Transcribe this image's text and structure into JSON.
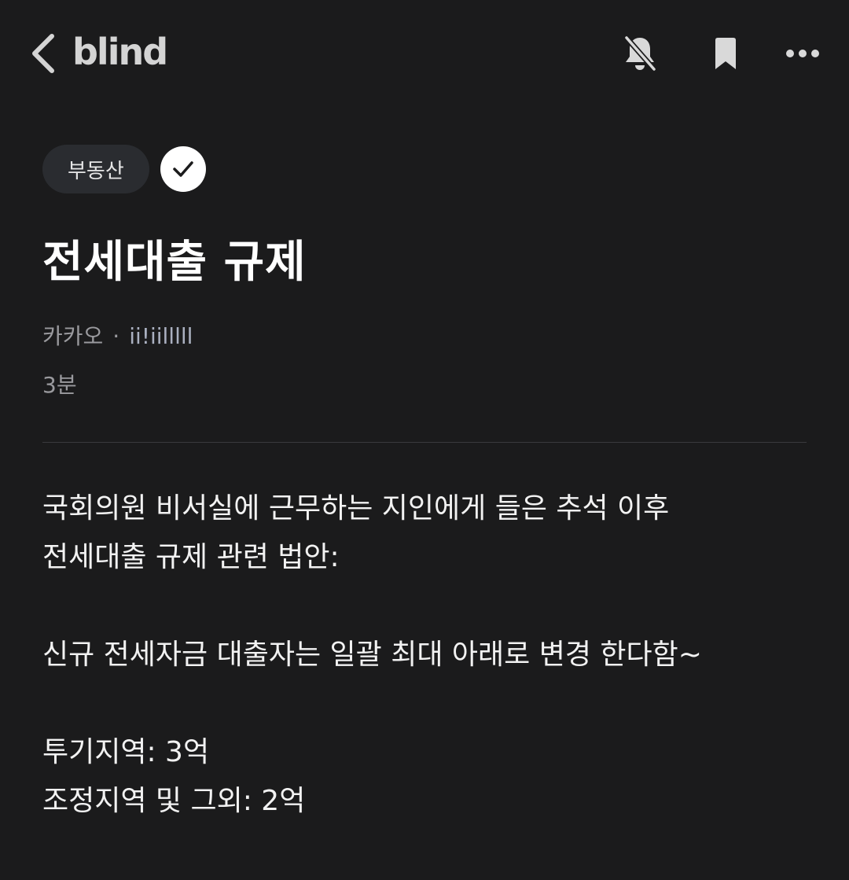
{
  "header": {
    "logo": "blind",
    "icons": {
      "back": "chevron-left-icon",
      "bell": "bell-muted-icon",
      "bookmark": "bookmark-icon",
      "more": "more-horizontal-icon"
    }
  },
  "post": {
    "category": "부동산",
    "title": "전세대출 규제",
    "company": "카카오",
    "separator": "·",
    "author": "ii!iilllll",
    "time": "3분",
    "body": {
      "line1": "국회의원 비서실에 근무하는 지인에게 들은 추석 이후",
      "line2": "전세대출 규제 관련 법안:",
      "line3": "신규 전세자금 대출자는 일괄 최대 아래로 변경 한다함~",
      "line4": "투기지역: 3억",
      "line5": "조정지역 및 그외: 2억"
    }
  },
  "colors": {
    "background": "#1b1b1c",
    "chip_bg": "#2a2c30",
    "text": "#ffffff",
    "muted": "#9a9a9e"
  }
}
